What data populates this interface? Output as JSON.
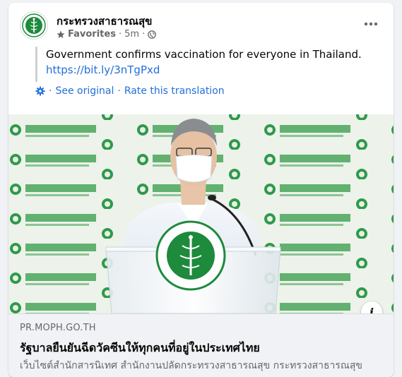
{
  "post": {
    "page_name": "กระทรวงสาธารณสุข",
    "audience": "Favorites",
    "separator": "·",
    "time": "5m",
    "text": "Government confirms vaccination for everyone in Thailand.",
    "link": "https://bit.ly/3nTgPxd",
    "translation": {
      "see_original": "See original",
      "rate": "Rate this translation",
      "sep": "·"
    }
  },
  "photo": {
    "backdrop_text_thai": "กระทรวงสาธารณสุข",
    "backdrop_text_en": "MINISTRY OF PUBLIC HEALTH THAILAND",
    "podium_seal_text": "กระทรวงสาธารณสุข",
    "podium_seal_en": "MINISTRY OF PUBLIC HEALTH",
    "info_glyph": "i"
  },
  "link_preview": {
    "domain": "PR.MOPH.GO.TH",
    "title": "รัฐบาลยืนยันฉีดวัคซีนให้ทุกคนที่อยู่ในประเทศไทย",
    "description": "เว็บไซต์สำนักสารนิเทศ สำนักงานปลัดกระทรวงสาธารณสุข กระทรวงสาธารณสุข"
  },
  "icons": {
    "avatar": "moph-logo-icon",
    "star": "star-icon",
    "globe": "globe-icon",
    "more": "more-options-icon",
    "gear": "gear-icon",
    "info": "info-icon"
  },
  "colors": {
    "brand_green": "#1d8a3c",
    "link_blue": "#216fdb",
    "secondary_text": "#65676b"
  }
}
